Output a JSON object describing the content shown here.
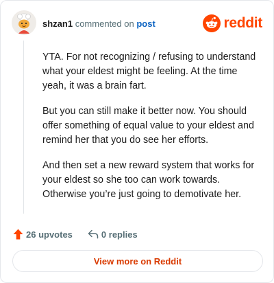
{
  "header": {
    "username": "shzan1",
    "verb": "commented on",
    "post_link": "post",
    "logo_word": "reddit",
    "logo_icon": "reddit-snoo-icon",
    "avatar_icon": "chef-avatar-icon"
  },
  "comment": {
    "paragraphs": [
      "YTA. For not recognizing / refusing to understand what your eldest might be feeling. At the time yeah, it was a brain fart.",
      "But you can still make it better now. You should offer something of equal value to your eldest and remind her that you do see her efforts.",
      "And then set a new reward system that works for your eldest so she too can work towards. Otherwise you’re just going to demotivate her."
    ]
  },
  "actions": {
    "upvotes_label": "26 upvotes",
    "replies_label": "0 replies",
    "upvote_icon": "upvote-arrow-icon",
    "reply_icon": "reply-icon"
  },
  "footer": {
    "view_more_label": "View more on Reddit"
  },
  "colors": {
    "brand": "#ff4500",
    "link": "#0b63c2",
    "cta_text": "#d93a00",
    "muted": "#576f76"
  }
}
